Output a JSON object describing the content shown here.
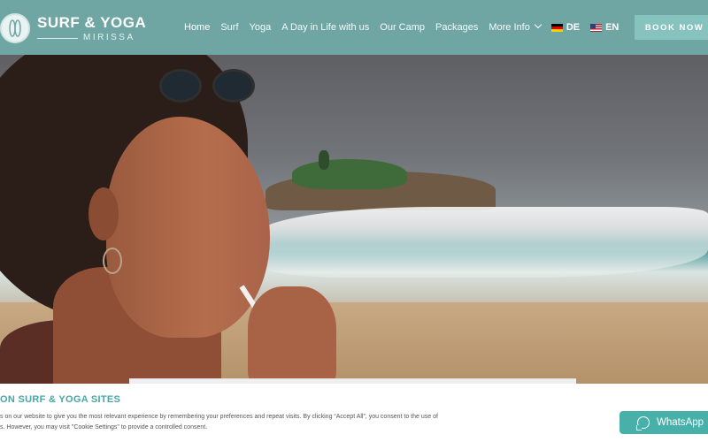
{
  "brand": {
    "title": "SURF & YOGA",
    "subtitle": "MIRISSA"
  },
  "nav": {
    "items": [
      {
        "label": "Home",
        "active": true
      },
      {
        "label": "Surf"
      },
      {
        "label": "Yoga"
      },
      {
        "label": "A Day in Life with us"
      },
      {
        "label": "Our Camp"
      },
      {
        "label": "Packages"
      },
      {
        "label": "More Info"
      }
    ],
    "languages": [
      "DE",
      "EN"
    ],
    "book_label": "BOOK NOW"
  },
  "cookie": {
    "title": "ON SURF & YOGA SITES",
    "text_line1": "s on our website to give you the most relevant experience by remembering your preferences and repeat visits. By clicking “Accept All”, you consent to the use of",
    "text_line2": "s. However, you may visit \"Cookie Settings\" to provide a controlled consent."
  },
  "whatsapp": {
    "label": "WhatsApp"
  },
  "colors": {
    "header_bg": "#6fa6a3",
    "button_bg": "#86c2be",
    "accent_text": "#4aa6a5",
    "whatsapp_bg": "#47b0a8"
  }
}
